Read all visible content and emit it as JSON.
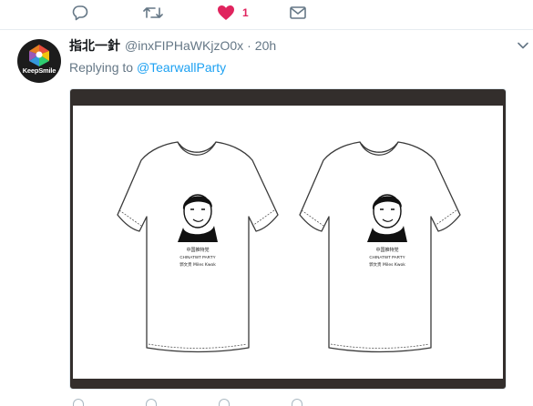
{
  "top_actions": {
    "reply_icon": "reply-bubble-icon",
    "retweet_icon": "retweet-icon",
    "like_icon": "heart-icon",
    "like_count": "1",
    "message_icon": "envelope-icon",
    "like_color": "#e0245e"
  },
  "tweet": {
    "avatar_text": "KeepSmile",
    "display_name": "指北一針",
    "handle": "@inxFIPHaWKjzO0x",
    "separator": "·",
    "time": "20h",
    "replying_to_prefix": "Replying to",
    "replying_to_handle": "@TearwallParty",
    "more_icon": "chevron-down-icon"
  },
  "media": {
    "description_icon": "t-shirt-image",
    "shirts": [
      {
        "caption_cn": "中国推特党",
        "caption_en": "CHINATWT PARTY",
        "caption_sub": "郭文贵 Miles Kwok"
      },
      {
        "caption_cn": "中国推特党",
        "caption_en": "CHINATWT PARTY",
        "caption_sub": "郭文贵 Miles Kwok"
      }
    ]
  },
  "colors": {
    "accent": "#1da1f2",
    "muted": "#657786",
    "text": "#14171a",
    "media_bg": "#332e2c"
  }
}
